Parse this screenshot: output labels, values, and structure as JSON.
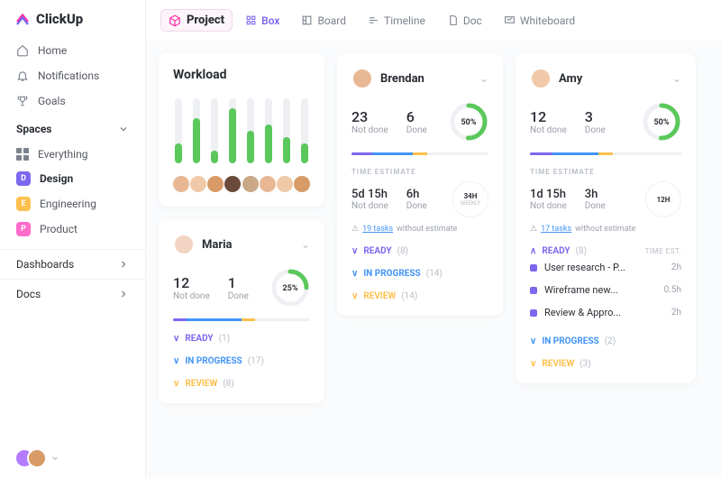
{
  "brand": "ClickUp",
  "nav": {
    "home": "Home",
    "notifications": "Notifications",
    "goals": "Goals"
  },
  "spaces": {
    "heading": "Spaces",
    "everything": "Everything",
    "items": [
      {
        "letter": "D",
        "color": "#7b68ee",
        "name": "Design"
      },
      {
        "letter": "E",
        "color": "#fdc04e",
        "name": "Engineering"
      },
      {
        "letter": "P",
        "color": "#ff6bcb",
        "name": "Product"
      }
    ]
  },
  "sections": {
    "dashboards": "Dashboards",
    "docs": "Docs"
  },
  "header": {
    "project": "Project",
    "views": [
      "Box",
      "Board",
      "Timeline",
      "Doc",
      "Whiteboard"
    ]
  },
  "workload": {
    "title": "Workload",
    "bars": [
      30,
      70,
      20,
      85,
      50,
      60,
      40,
      30
    ]
  },
  "people": [
    {
      "name": "Maria",
      "notdone": 12,
      "done": 1,
      "pct": "25%",
      "seg": [
        10,
        40,
        10
      ],
      "statuses": [
        {
          "label": "READY",
          "count": "(1)",
          "color": "#7b68ee"
        },
        {
          "label": "IN PROGRESS",
          "count": "(17)",
          "color": "#4194f6"
        },
        {
          "label": "REVIEW",
          "count": "(8)",
          "color": "#fdc04e"
        }
      ]
    },
    {
      "name": "Brendan",
      "notdone": 23,
      "done": 6,
      "pct": "50%",
      "seg": [
        15,
        30,
        10
      ],
      "estimate": {
        "notdone": "5d 15h",
        "done": "6h",
        "cap": "34H",
        "capsub": "WEEKLY"
      },
      "note_pre": "19 tasks",
      "note_rest": " without estimate",
      "statuses": [
        {
          "label": "READY",
          "count": "(8)",
          "color": "#7b68ee"
        },
        {
          "label": "IN PROGRESS",
          "count": "(14)",
          "color": "#4194f6"
        },
        {
          "label": "REVIEW",
          "count": "(14)",
          "color": "#fdc04e"
        }
      ]
    },
    {
      "name": "Amy",
      "notdone": 12,
      "done": 3,
      "pct": "50%",
      "seg": [
        15,
        30,
        10
      ],
      "estimate": {
        "notdone": "1d 15h",
        "done": "3h",
        "cap": "12H",
        "capsub": ""
      },
      "note_pre": "17 tasks",
      "note_rest": " without estimate",
      "ready_expanded": true,
      "est_head": "TIME EST.",
      "tasks": [
        {
          "name": "User research - P...",
          "est": "2h"
        },
        {
          "name": "Wireframe new...",
          "est": "0.5h"
        },
        {
          "name": "Review & Appro...",
          "est": "2h"
        }
      ],
      "statuses": [
        {
          "label": "READY",
          "count": "(8)",
          "color": "#7b68ee"
        },
        {
          "label": "IN PROGRESS",
          "count": "(2)",
          "color": "#4194f6"
        },
        {
          "label": "REVIEW",
          "count": "(3)",
          "color": "#fdc04e"
        }
      ]
    }
  ],
  "te_label": "TIME ESTIMATE",
  "stat_labels": {
    "notdone": "Not done",
    "done": "Done"
  }
}
